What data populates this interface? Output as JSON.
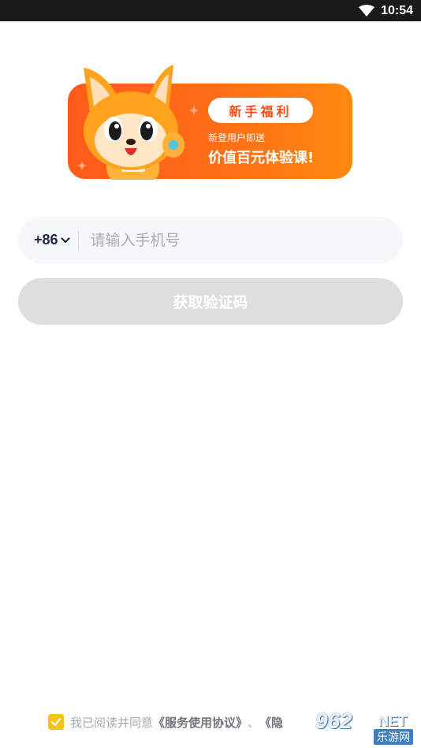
{
  "status_bar": {
    "time": "10:54",
    "wifi_icon": "wifi-icon"
  },
  "banner": {
    "pill_label": "新手福利",
    "subtitle": "新登用户即送",
    "headline": "价值百元体验课!",
    "mascot": "fox-mascot",
    "colors": {
      "gradient_start": "#ff5a1a",
      "gradient_end": "#ff8a10",
      "pill_text": "#ff4a10"
    }
  },
  "login": {
    "country_code": "+86",
    "phone_placeholder": "请输入手机号",
    "get_code_label": "获取验证码"
  },
  "agreement": {
    "checked": true,
    "prefix": "我已阅读并同意",
    "service_link": "《服务使用协议》",
    "separator": "、",
    "privacy_link": "《隐"
  },
  "watermark": {
    "number": "962",
    "net": "NET",
    "site": "乐游网"
  }
}
